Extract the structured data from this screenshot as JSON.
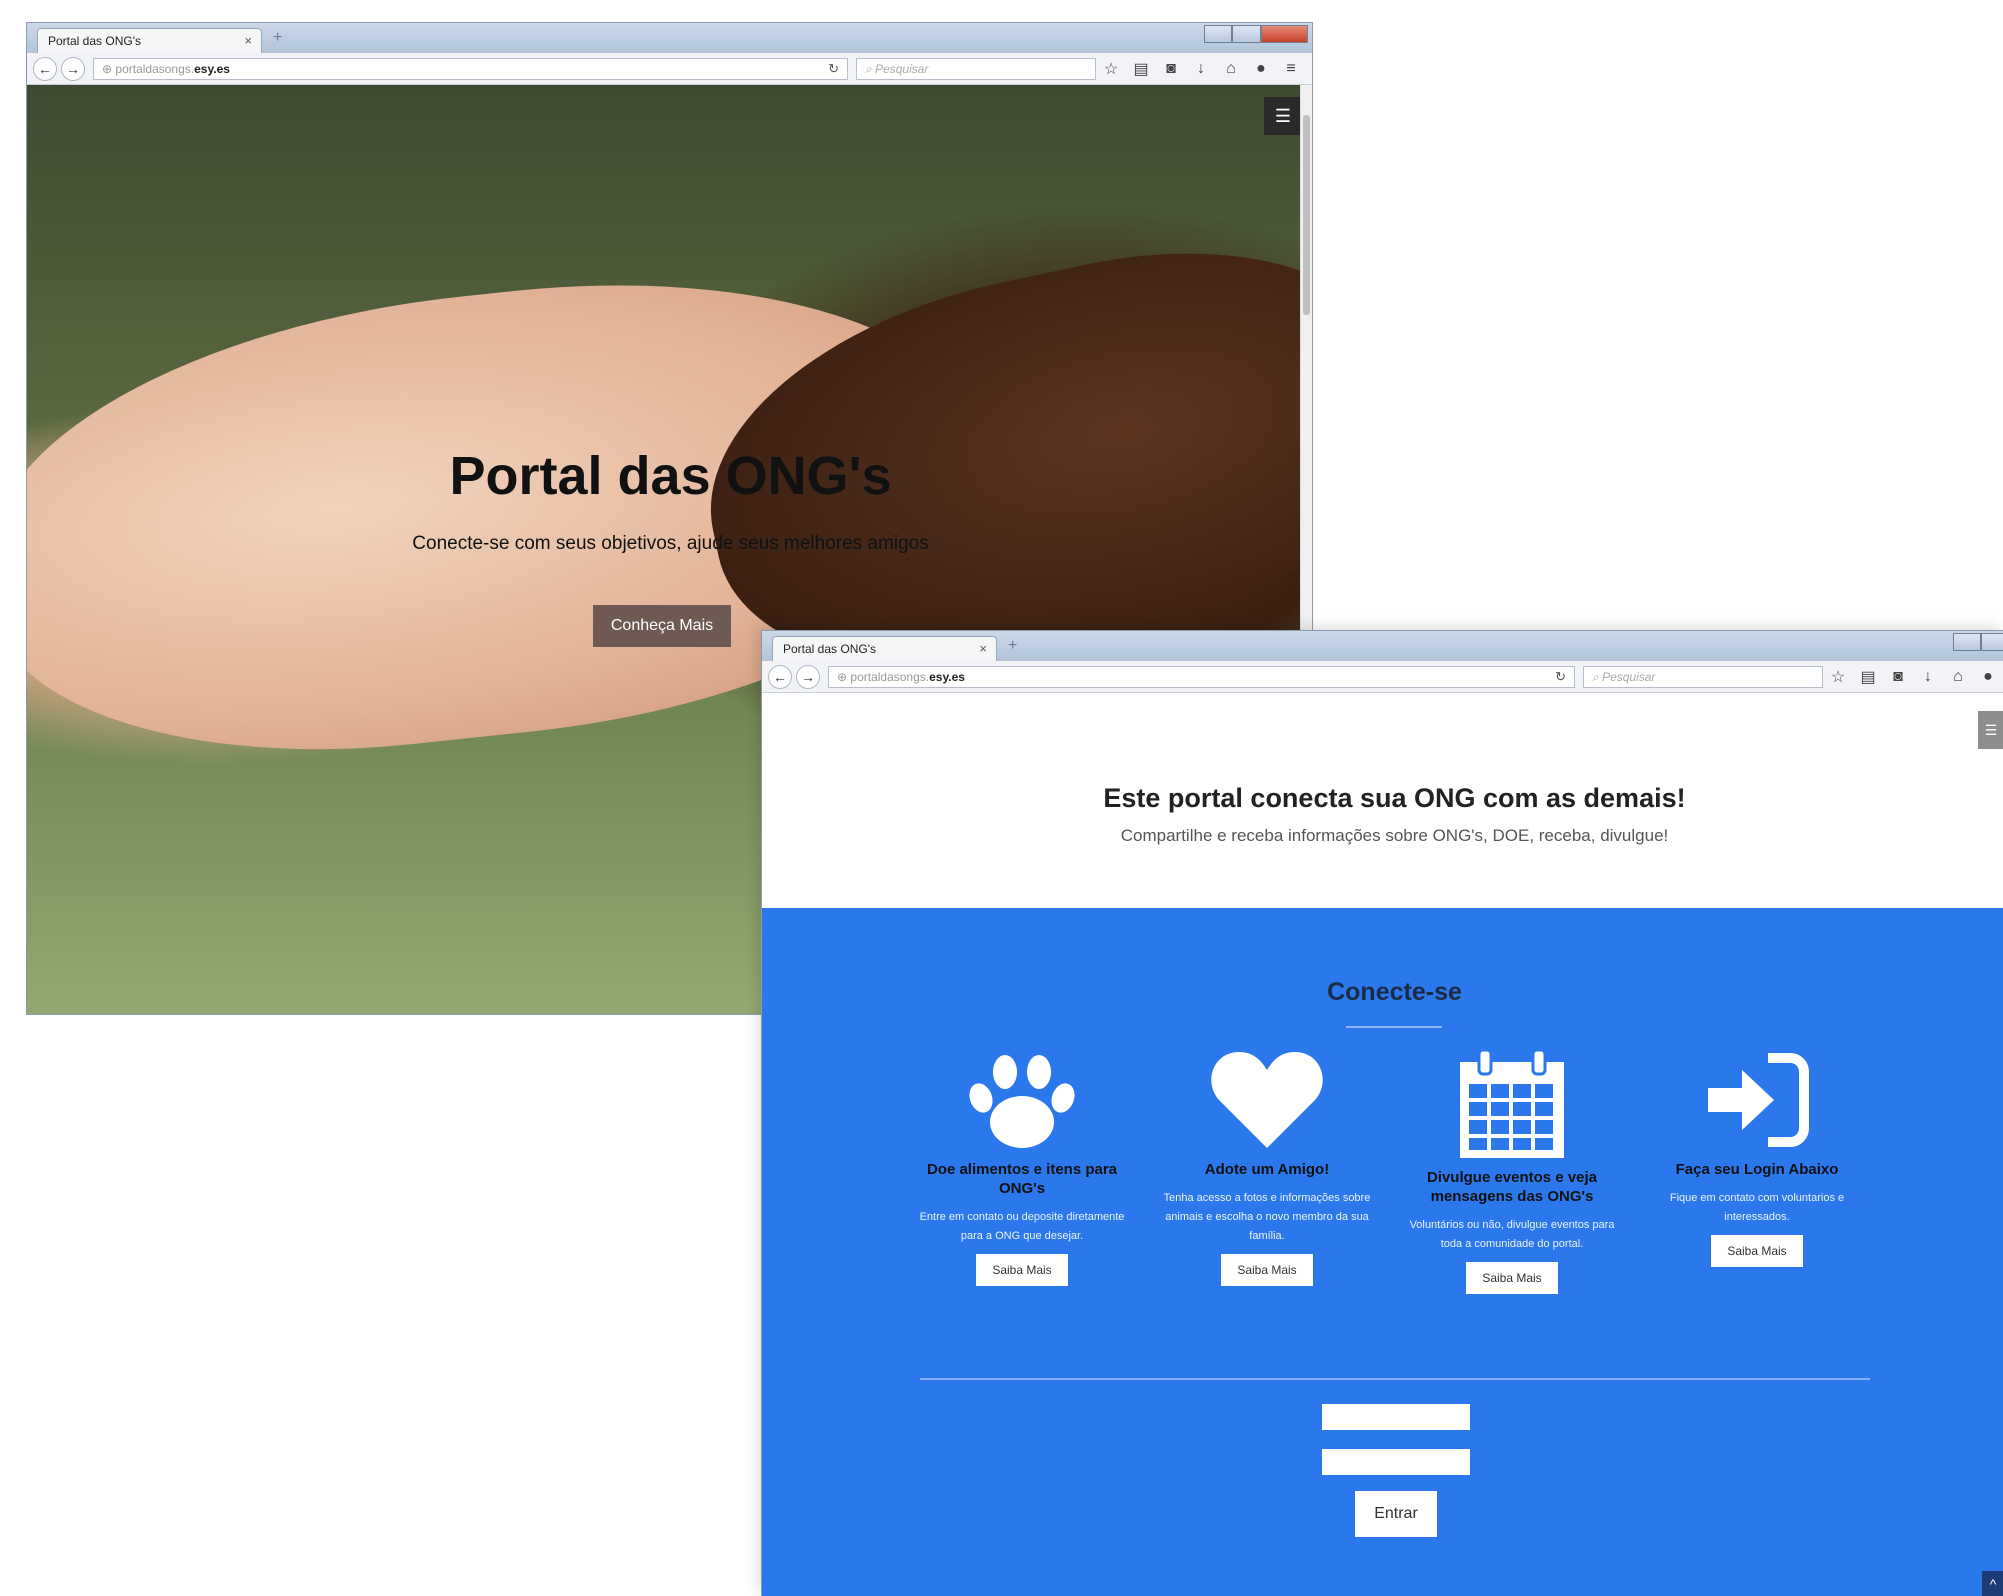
{
  "window_a": {
    "tab_title": "Portal das ONG's",
    "url_host": "portaldasongs.",
    "url_domain": "esy.es",
    "search_placeholder": "Pesquisar",
    "hero": {
      "title": "Portal das ONG's",
      "subtitle": "Conecte-se com seus objetivos, ajude seus melhores amigos",
      "button": "Conheça Mais"
    }
  },
  "window_b": {
    "tab_title": "Portal das ONG's",
    "url_host": "portaldasongs.",
    "url_domain": "esy.es",
    "search_placeholder": "Pesquisar",
    "intro": {
      "title": "Este portal conecta sua ONG com as demais!",
      "subtitle": "Compartilhe e receba informações sobre ONG's, DOE, receba, divulgue!"
    },
    "connect": {
      "title": "Conecte-se",
      "features": [
        {
          "icon": "paw-icon",
          "title": "Doe alimentos e itens para ONG's",
          "text": "Entre em contato ou deposite diretamente para a ONG que desejar.",
          "button": "Saiba Mais"
        },
        {
          "icon": "heart-icon",
          "title": "Adote um Amigo!",
          "text": "Tenha acesso a fotos e informações sobre animais e escolha o novo membro da sua família.",
          "button": "Saiba Mais"
        },
        {
          "icon": "calendar-icon",
          "title": "Divulgue eventos e veja mensagens das ONG's",
          "text": "Voluntários ou não, divulgue eventos para toda a comunidade do portal.",
          "button": "Saiba Mais"
        },
        {
          "icon": "sign-in-icon",
          "title": "Faça seu Login Abaixo",
          "text": "Fique em contato com voluntarios e interessados.",
          "button": "Saiba Mais"
        }
      ],
      "login": {
        "username_value": "",
        "password_value": "",
        "submit": "Entrar"
      }
    }
  },
  "colors": {
    "section_blue": "#2b78ec",
    "hero_button": "#6e5a52"
  }
}
